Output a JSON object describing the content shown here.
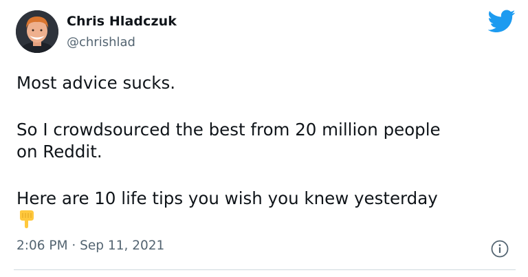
{
  "tweet": {
    "display_name": "Chris Hladczuk",
    "handle": "@chrishlad",
    "text_lines": [
      "Most advice sucks.",
      "So I crowdsourced the best from 20 million people",
      "on Reddit.",
      "Here are 10 life tips you wish you knew yesterday"
    ],
    "timestamp": "2:06 PM · Sep 11, 2021"
  },
  "icons": {
    "brand": "twitter-bird-icon",
    "emoji": "pointing-down-hand-emoji",
    "info": "info-icon"
  },
  "colors": {
    "twitter_blue": "#1d9bf0",
    "text_primary": "#0f1419",
    "text_secondary": "#536471",
    "emoji_yellow": "#ffc83d",
    "divider": "#cfd9de"
  }
}
